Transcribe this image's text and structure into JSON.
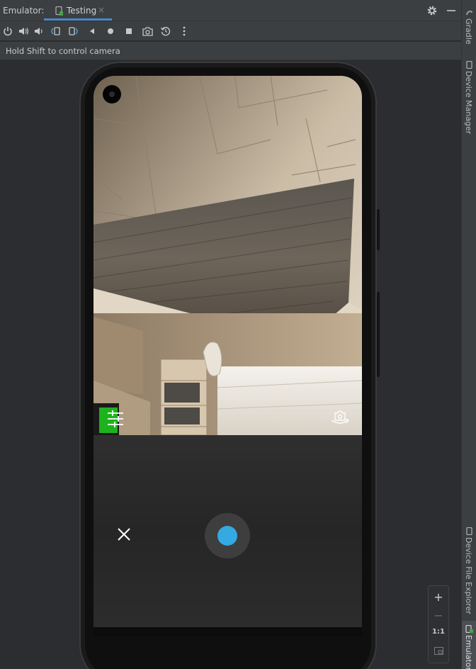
{
  "app": {
    "label": "Emulator:"
  },
  "tab": {
    "label": "Testing",
    "close": "×"
  },
  "hint": {
    "text": "Hold Shift to control camera"
  },
  "toolbar": {
    "items": [
      "power-icon",
      "volume-up-icon",
      "volume-down-icon",
      "rotate-left-icon",
      "rotate-right-icon",
      "back-icon",
      "home-icon",
      "overview-icon",
      "screenshot-icon",
      "snapshot-icon",
      "more-icon"
    ]
  },
  "side_panels": {
    "top": [
      "Gradle",
      "Device Manager"
    ],
    "bottom": [
      "Device File Explorer",
      "Emulator"
    ]
  },
  "zoom": {
    "plus": "+",
    "minus": "−",
    "ratio": "1:1"
  },
  "camera": {
    "shutter_color": "#35a9e1",
    "close_icon": "close-icon",
    "settings_icon": "settings-sliders-icon",
    "flip_icon": "flip-camera-icon"
  },
  "colors": {
    "accent": "#4a88c7",
    "shutter": "#35a9e1"
  }
}
